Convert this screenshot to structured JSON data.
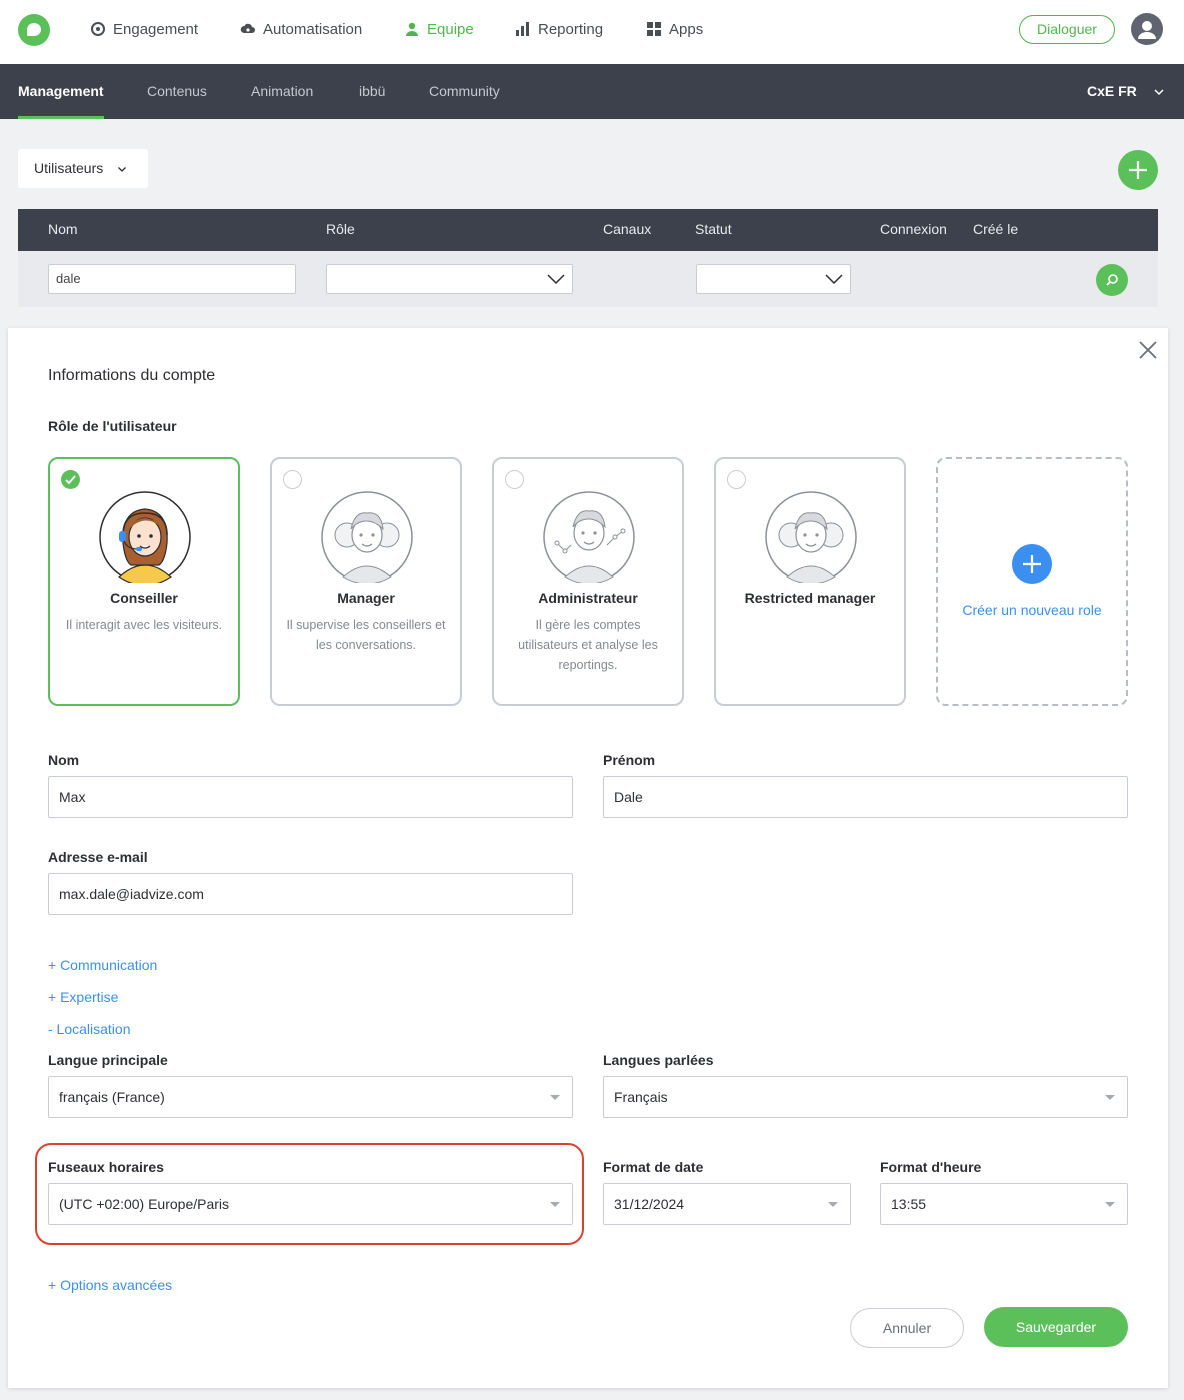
{
  "topnav": {
    "items": [
      {
        "label": "Engagement",
        "icon": "target-icon"
      },
      {
        "label": "Automatisation",
        "icon": "cloud-gear-icon"
      },
      {
        "label": "Equipe",
        "icon": "user-icon",
        "active": true
      },
      {
        "label": "Reporting",
        "icon": "bar-chart-icon"
      },
      {
        "label": "Apps",
        "icon": "grid-icon"
      }
    ],
    "dialoguer_label": "Dialoguer"
  },
  "subnav": {
    "items": [
      "Management",
      "Contenus",
      "Animation",
      "ibbü",
      "Community"
    ],
    "active": "Management",
    "workspace": "CxE FR"
  },
  "filters": {
    "view_select": "Utilisateurs",
    "columns": [
      "Nom",
      "Rôle",
      "Canaux",
      "Statut",
      "Connexion",
      "Créé le"
    ],
    "name_value": "dale"
  },
  "panel": {
    "title": "Informations du compte",
    "role_label": "Rôle de l'utilisateur",
    "roles": [
      {
        "name": "Conseiller",
        "desc": "Il interagit avec les visiteurs.",
        "selected": true
      },
      {
        "name": "Manager",
        "desc": "Il supervise les conseillers et les conversations.",
        "selected": false
      },
      {
        "name": "Administrateur",
        "desc": "Il gère les comptes utilisateurs et analyse les reportings.",
        "selected": false
      },
      {
        "name": "Restricted manager",
        "desc": "",
        "selected": false
      }
    ],
    "new_role": "Créer un nouveau role",
    "nom_label": "Nom",
    "nom_value": "Max",
    "prenom_label": "Prénom",
    "prenom_value": "Dale",
    "email_label": "Adresse e-mail",
    "email_value": "max.dale@iadvize.com",
    "links": {
      "communication": "+ Communication",
      "expertise": "+ Expertise",
      "localisation": "- Localisation",
      "options": "+ Options avancées"
    },
    "langue_label": "Langue principale",
    "langue_value": "français (France)",
    "langues_label": "Langues parlées",
    "langues_value": "Français",
    "fuseau_label": "Fuseaux horaires",
    "fuseau_value": "(UTC +02:00) Europe/Paris",
    "date_label": "Format de date",
    "date_value": "31/12/2024",
    "heure_label": "Format d'heure",
    "heure_value": "13:55",
    "cancel_label": "Annuler",
    "save_label": "Sauvegarder"
  },
  "colors": {
    "brand_green": "#5cc05a",
    "nav_dark": "#3c414c",
    "link_blue": "#3b8ff0",
    "highlight_red": "#d8432f"
  }
}
